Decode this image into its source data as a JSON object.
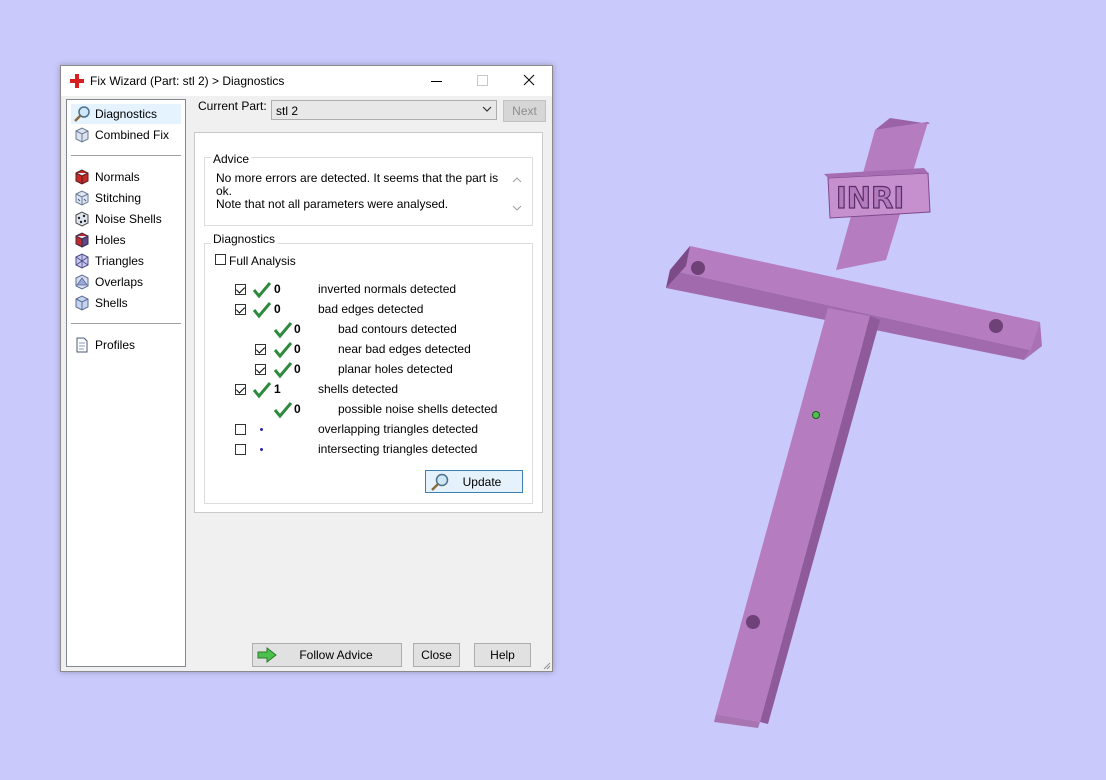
{
  "window": {
    "title": "Fix Wizard (Part: stl 2) > Diagnostics",
    "title_icon": "red-cross-icon",
    "controls": [
      "minimize-icon",
      "maximize-icon",
      "close-icon"
    ]
  },
  "nav": {
    "items": [
      {
        "label": "Diagnostics",
        "icon": "magnifier-icon",
        "selected": true
      },
      {
        "label": "Combined Fix",
        "icon": "cube-icon"
      },
      {
        "label": "Normals",
        "icon": "normals-cube-icon"
      },
      {
        "label": "Stitching",
        "icon": "stitching-cube-icon"
      },
      {
        "label": "Noise Shells",
        "icon": "noise-shells-icon"
      },
      {
        "label": "Holes",
        "icon": "holes-cube-icon"
      },
      {
        "label": "Triangles",
        "icon": "triangles-icon"
      },
      {
        "label": "Overlaps",
        "icon": "overlaps-icon"
      },
      {
        "label": "Shells",
        "icon": "shells-cube-icon"
      },
      {
        "label": "Profiles",
        "icon": "document-icon"
      }
    ]
  },
  "current_part": {
    "label": "Current Part:",
    "value": "stl 2",
    "next_label": "Next"
  },
  "advice": {
    "title": "Advice",
    "line1": "No more errors are detected. It seems that the part is ok.",
    "line2": "Note that not all parameters were analysed."
  },
  "diagnostics": {
    "title": "Diagnostics",
    "full_analysis_label": "Full Analysis",
    "full_analysis_checked": false,
    "rows": [
      {
        "checked": true,
        "count": "0",
        "text": "inverted normals detected"
      },
      {
        "checked": true,
        "count": "0",
        "text": "bad edges detected"
      },
      {
        "count": "0",
        "text": "bad contours detected"
      },
      {
        "checked": true,
        "count": "0",
        "text": "near bad edges detected"
      },
      {
        "checked": true,
        "count": "0",
        "text": "planar holes detected"
      },
      {
        "checked": true,
        "count": "1",
        "text": "shells detected"
      },
      {
        "count": "0",
        "text": "possible noise shells detected"
      },
      {
        "checked": false,
        "text": "overlapping triangles detected"
      },
      {
        "checked": false,
        "text": "intersecting triangles detected"
      }
    ],
    "update_label": "Update"
  },
  "footer": {
    "follow_label": "Follow Advice",
    "close_label": "Close",
    "help_label": "Help"
  },
  "model": {
    "inscription": "INRI",
    "color": "#c88cd0"
  }
}
